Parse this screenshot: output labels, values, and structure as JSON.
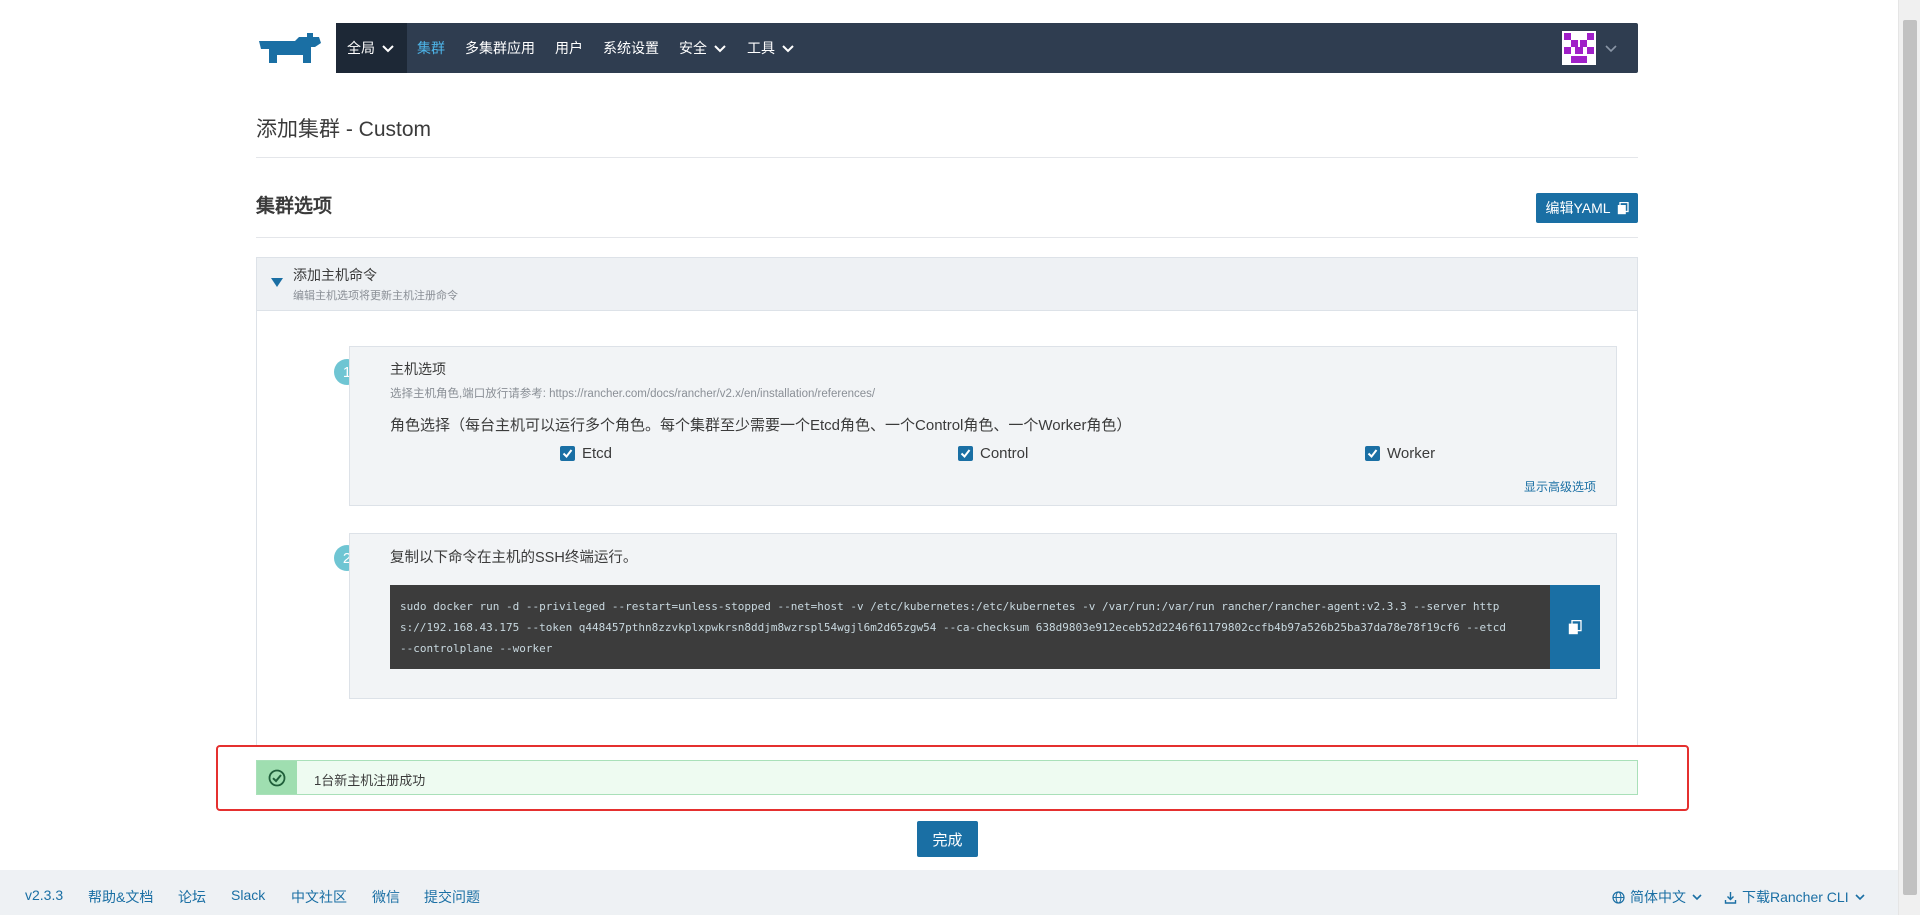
{
  "nav": {
    "global": "全局",
    "items": [
      "集群",
      "多集群应用",
      "用户",
      "系统设置",
      "安全",
      "工具"
    ]
  },
  "page": {
    "title": "添加集群 - Custom",
    "section_title": "集群选项",
    "edit_yaml": "编辑YAML"
  },
  "accordion": {
    "title": "添加主机命令",
    "subtitle": "编辑主机选项将更新主机注册命令"
  },
  "step1": {
    "number": "1",
    "title": "主机选项",
    "subtitle": "选择主机角色,端口放行请参考: https://rancher.com/docs/rancher/v2.x/en/installation/references/",
    "role_text": "角色选择（每台主机可以运行多个角色。每个集群至少需要一个Etcd角色、一个Control角色、一个Worker角色）",
    "roles": [
      "Etcd",
      "Control",
      "Worker"
    ],
    "advanced_link": "显示高级选项"
  },
  "step2": {
    "number": "2",
    "title": "复制以下命令在主机的SSH终端运行。",
    "command": "sudo docker run -d --privileged --restart=unless-stopped --net=host -v /etc/kubernetes:/etc/kubernetes -v /var/run:/var/run rancher/rancher-agent:v2.3.3 --server https://192.168.43.175 --token q448457pthn8zzvkplxpwkrsn8ddjm8wzrspl54wgjl6m2d65zgw54 --ca-checksum 638d9803e912eceb52d2246f61179802ccfb4b97a526b25ba37da78e78f19cf6 --etcd --controlplane --worker"
  },
  "banner": {
    "text": "1台新主机注册成功"
  },
  "done_button": "完成",
  "footer": {
    "links": [
      "v2.3.3",
      "帮助&文档",
      "论坛",
      "Slack",
      "中文社区",
      "微信",
      "提交问题"
    ],
    "language": "简体中文",
    "download": "下载Rancher CLI"
  },
  "colors": {
    "nav_bg": "#2f3d50",
    "accent": "#1a6fa4",
    "success": "#9fdeb0",
    "highlight_border": "#e5302f"
  }
}
